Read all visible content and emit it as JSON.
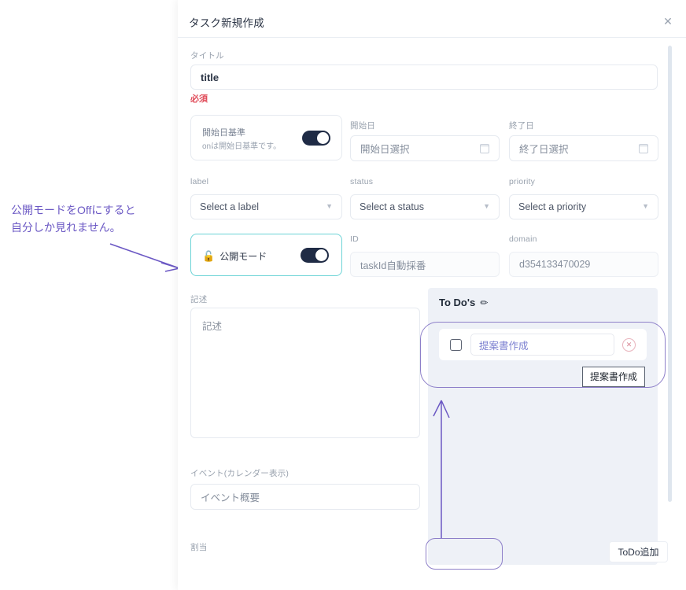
{
  "modal": {
    "title": "タスク新規作成",
    "close_icon": "close-icon"
  },
  "form": {
    "title_field": {
      "label": "タイトル",
      "value": "title",
      "required_note": "必須"
    },
    "start_basis": {
      "title": "開始日基準",
      "sub": "onは開始日基準です。",
      "toggle_state": "on"
    },
    "start_date": {
      "label": "開始日",
      "placeholder": "開始日選択",
      "icon": "calendar-icon"
    },
    "end_date": {
      "label": "終了日",
      "placeholder": "終了日選択",
      "icon": "calendar-icon"
    },
    "label_select": {
      "label": "label",
      "value": "Select a label"
    },
    "status_select": {
      "label": "status",
      "value": "Select a status"
    },
    "priority_select": {
      "label": "priority",
      "value": "Select a priority"
    },
    "public_mode": {
      "icon": "🔓",
      "title": "公開モード",
      "toggle_state": "on"
    },
    "id_field": {
      "label": "ID",
      "value": "taskId自動採番"
    },
    "domain_field": {
      "label": "domain",
      "value": "d354133470029"
    },
    "description": {
      "label": "記述",
      "placeholder": "記述"
    },
    "event": {
      "label": "イベント(カレンダー表示)",
      "placeholder": "イベント概要"
    },
    "assignee": {
      "label": "割当"
    }
  },
  "todo": {
    "heading": "To Do's",
    "edit_icon": "✏",
    "items": [
      {
        "value": "提案書作成",
        "checked": false,
        "delete_icon": "✕"
      }
    ],
    "tooltip": "提案書作成",
    "add_button": "ToDo追加"
  },
  "annotations": {
    "public_mode_note_line1": "公開モードをOffにすると",
    "public_mode_note_line2": "自分しか見れません。"
  },
  "colors": {
    "accent_purple": "#6b58c4",
    "toggle_on": "#1f2b45",
    "required_red": "#e04b59",
    "accent_teal": "#6cd3d6",
    "panel_bg": "#eef1f7"
  }
}
